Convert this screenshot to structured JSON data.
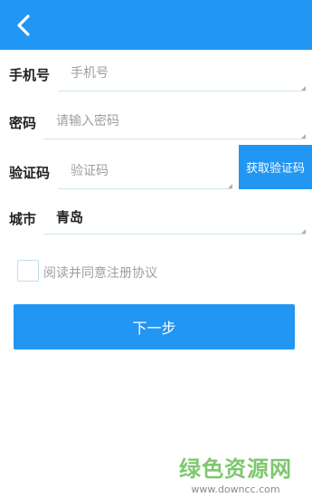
{
  "header": {
    "back_icon": "chevron-left-icon"
  },
  "form": {
    "phone": {
      "label": "手机号",
      "placeholder": "手机号",
      "value": ""
    },
    "password": {
      "label": "密码",
      "placeholder": "请输入密码",
      "value": ""
    },
    "code": {
      "label": "验证码",
      "placeholder": "验证码",
      "value": "",
      "button_label": "获取验证码"
    },
    "city": {
      "label": "城市",
      "value": "青岛"
    }
  },
  "agreement": {
    "label": "阅读并同意注册协议",
    "checked": false
  },
  "next_button": {
    "label": "下一步"
  },
  "watermark": {
    "main": "绿色资源网",
    "sub": "www.downcc.com"
  },
  "colors": {
    "primary": "#2196f3",
    "watermark_green": "#7ec76f"
  }
}
